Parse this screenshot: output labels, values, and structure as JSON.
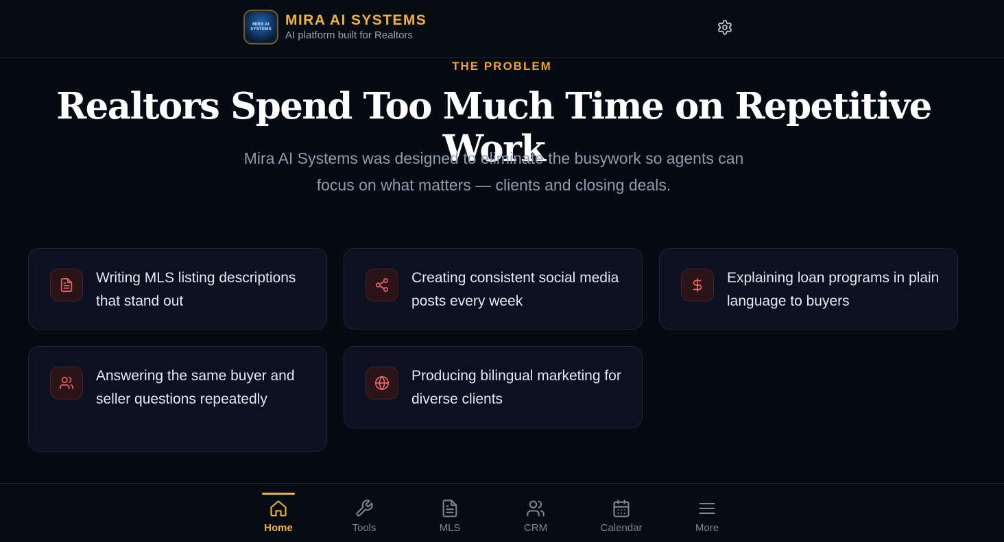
{
  "header": {
    "brand_title": "MIRA AI SYSTEMS",
    "brand_subtitle": "AI platform built for Realtors",
    "logo_text": "MIRA AI SYSTEMS",
    "settings_icon": "gear-icon"
  },
  "hero": {
    "eyebrow": "THE PROBLEM",
    "headline": "Realtors Spend Too Much Time on Repetitive Work",
    "subtitle_line1": "Mira AI Systems was designed to eliminate the busywork so agents can",
    "subtitle_line2": "focus on what matters — clients and closing deals."
  },
  "problems": [
    {
      "icon": "document-icon",
      "text": "Writing MLS listing descriptions that stand out"
    },
    {
      "icon": "share-icon",
      "text": "Creating consistent social media posts every week"
    },
    {
      "icon": "dollar-icon",
      "text": "Explaining loan programs in plain language to buyers"
    },
    {
      "icon": "users-icon",
      "text": "Answering the same buyer and seller questions repeatedly"
    },
    {
      "icon": "globe-icon",
      "text": "Producing bilingual marketing for diverse clients"
    }
  ],
  "nav": {
    "items": [
      {
        "label": "Home",
        "icon": "home-icon",
        "active": true
      },
      {
        "label": "Tools",
        "icon": "wrench-icon"
      },
      {
        "label": "MLS",
        "icon": "document-icon"
      },
      {
        "label": "CRM",
        "icon": "users-icon"
      },
      {
        "label": "Calendar",
        "icon": "calendar-icon"
      },
      {
        "label": "More",
        "icon": "menu-icon"
      }
    ]
  },
  "colors": {
    "accent": "#f0b33a",
    "background": "#060a12",
    "card_bg": "#0b1120",
    "icon_red": "#f0646a"
  }
}
